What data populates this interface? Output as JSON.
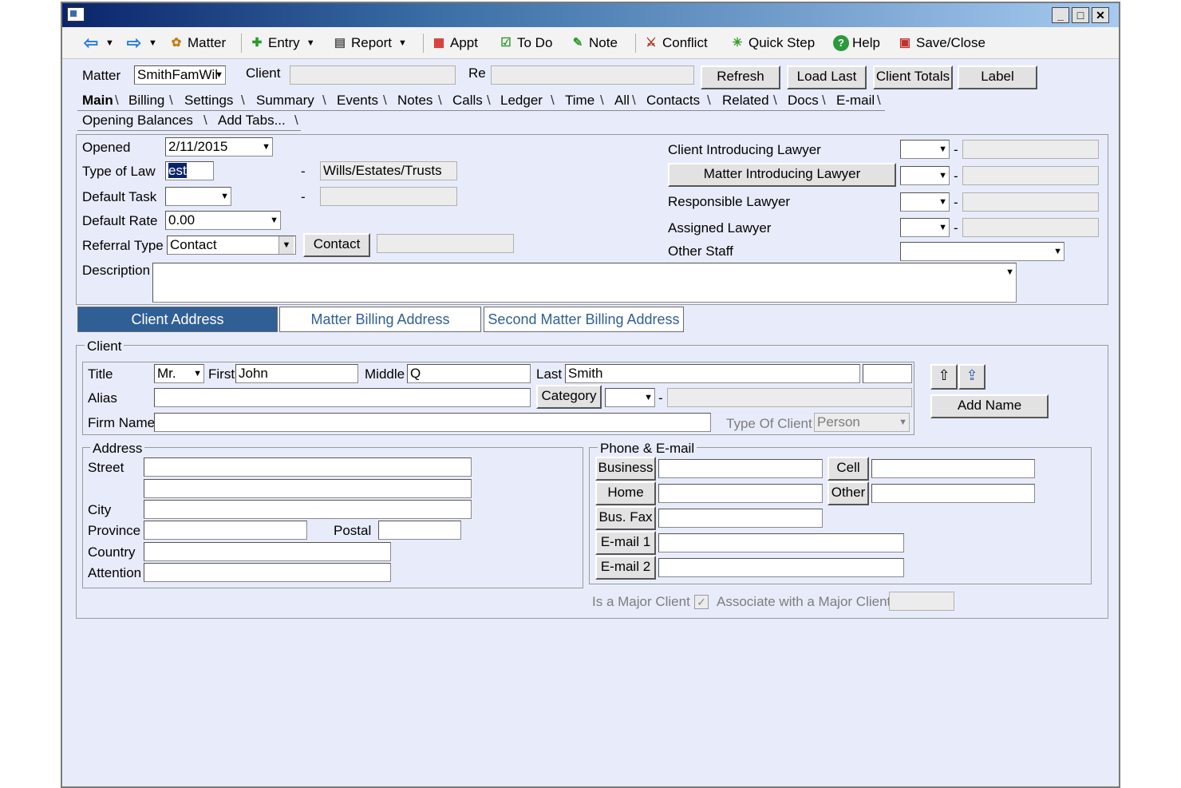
{
  "toolbar": {
    "matter": "Matter",
    "entry": "Entry",
    "report": "Report",
    "appt": "Appt",
    "todo": "To Do",
    "note": "Note",
    "conflict": "Conflict",
    "quickstep": "Quick Step",
    "help": "Help",
    "saveclose": "Save/Close"
  },
  "header": {
    "matter_label": "Matter",
    "matter_value": "SmithFamWil",
    "client_label": "Client",
    "client_value": "",
    "re_label": "Re",
    "re_value": "",
    "refresh": "Refresh",
    "load_last": "Load Last",
    "client_totals": "Client Totals",
    "label": "Label"
  },
  "tabs": [
    "Main",
    "Billing",
    "Settings",
    "Summary",
    "Events",
    "Notes",
    "Calls",
    "Ledger",
    "Time",
    "All",
    "Contacts",
    "Related",
    "Docs",
    "E-mail"
  ],
  "tabs2": [
    "Opening Balances",
    "Add Tabs..."
  ],
  "main": {
    "opened_label": "Opened",
    "opened_value": "2/11/2015",
    "type_of_law_label": "Type of Law",
    "type_of_law_code": "est",
    "type_of_law_desc": "Wills/Estates/Trusts",
    "default_task_label": "Default Task",
    "default_task_value": "",
    "default_task_desc": "",
    "default_rate_label": "Default Rate",
    "default_rate_value": "0.00",
    "referral_type_label": "Referral Type",
    "referral_type_value": "Contact",
    "contact_button": "Contact",
    "contact_value": "",
    "description_label": "Description",
    "description_value": "",
    "dash": "-",
    "client_introducing_lawyer": "Client Introducing Lawyer",
    "matter_introducing_lawyer": "Matter Introducing Lawyer",
    "responsible_lawyer": "Responsible Lawyer",
    "assigned_lawyer": "Assigned Lawyer",
    "other_staff": "Other Staff"
  },
  "address_tabs": {
    "client_address": "Client Address",
    "matter_billing_address": "Matter Billing Address",
    "second_matter_billing_address": "Second Matter Billing Address"
  },
  "client": {
    "group_title": "Client",
    "title_label": "Title",
    "title_value": "Mr.",
    "first_label": "First",
    "first_value": "John",
    "middle_label": "Middle",
    "middle_value": "Q",
    "last_label": "Last",
    "last_value": "Smith",
    "suffix_value": "",
    "alias_label": "Alias",
    "alias_value": "",
    "category_button": "Category",
    "category_value": "",
    "category_desc": "",
    "firm_name_label": "Firm Name",
    "firm_name_value": "",
    "type_of_client_label": "Type Of Client",
    "type_of_client_value": "Person",
    "add_name_button": "Add Name"
  },
  "address": {
    "group_title": "Address",
    "street_label": "Street",
    "street1": "",
    "street2": "",
    "city_label": "City",
    "city_value": "",
    "province_label": "Province",
    "province_value": "",
    "postal_label": "Postal",
    "postal_value": "",
    "country_label": "Country",
    "country_value": "",
    "attention_label": "Attention",
    "attention_value": ""
  },
  "phone": {
    "group_title": "Phone & E-mail",
    "business": "Business",
    "home": "Home",
    "bus_fax": "Bus. Fax",
    "email1": "E-mail 1",
    "email2": "E-mail 2",
    "cell": "Cell",
    "other": "Other"
  },
  "footer": {
    "is_major_client": "Is a Major Client",
    "associate": "Associate with a Major Client"
  },
  "colors": {
    "accent": "#2f5f95",
    "window_bg": "#e8ecfa"
  }
}
